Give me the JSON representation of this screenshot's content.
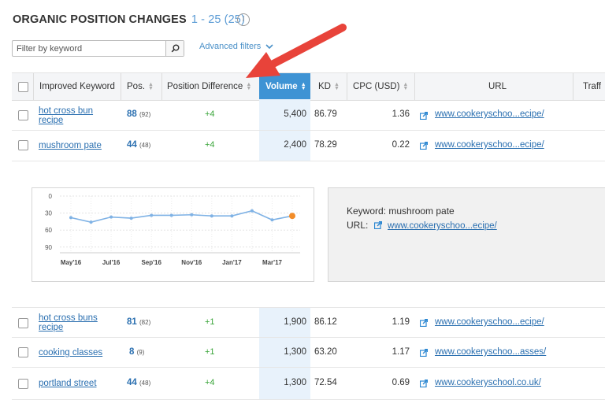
{
  "header": {
    "title": "ORGANIC POSITION CHANGES",
    "range": "1 - 25 (25)",
    "info_glyph": "i"
  },
  "filter": {
    "placeholder": "Filter by keyword",
    "advanced_label": "Advanced filters"
  },
  "table": {
    "columns": {
      "keyword": "Improved Keyword",
      "pos": "Pos.",
      "diff": "Position Difference",
      "volume": "Volume",
      "kd": "KD",
      "cpc": "CPC (USD)",
      "url": "URL",
      "traffic": "Traff"
    },
    "rows_top": [
      {
        "kw1": "hot cross bun",
        "kw2": "recipe",
        "pos": "88",
        "prev": "(92)",
        "diff": "+4",
        "volume": "5,400",
        "kd": "86.79",
        "cpc": "1.36",
        "url": "www.cookeryschoo...ecipe/"
      },
      {
        "kw1": "mushroom pate",
        "kw2": "",
        "pos": "44",
        "prev": "(48)",
        "diff": "+4",
        "volume": "2,400",
        "kd": "78.29",
        "cpc": "0.22",
        "url": "www.cookeryschoo...ecipe/"
      }
    ],
    "rows_bottom": [
      {
        "kw1": "hot cross buns",
        "kw2": "recipe",
        "pos": "81",
        "prev": "(82)",
        "diff": "+1",
        "volume": "1,900",
        "kd": "86.12",
        "cpc": "1.19",
        "url": "www.cookeryschoo...ecipe/"
      },
      {
        "kw1": "cooking classes",
        "kw2": "",
        "pos": "8",
        "prev": "(9)",
        "diff": "+1",
        "volume": "1,300",
        "kd": "63.20",
        "cpc": "1.17",
        "url": "www.cookeryschoo...asses/"
      },
      {
        "kw1": "portland street",
        "kw2": "",
        "pos": "44",
        "prev": "(48)",
        "diff": "+4",
        "volume": "1,300",
        "kd": "72.54",
        "cpc": "0.69",
        "url": "www.cookeryschool.co.uk/"
      }
    ]
  },
  "detail": {
    "keyword_label": "Keyword: mushroom pate",
    "url_label": "URL:",
    "url": "www.cookeryschoo...ecipe/"
  },
  "chart_data": {
    "type": "line",
    "x_ticks": [
      "May'16",
      "Jul'16",
      "Sep'16",
      "Nov'16",
      "Jan'17",
      "Mar'17"
    ],
    "y_ticks": [
      "0",
      "30",
      "60",
      "90"
    ],
    "ylim": [
      0,
      100
    ],
    "y_inverted": true,
    "x": [
      0,
      1,
      2,
      3,
      4,
      5,
      6,
      7,
      8,
      9,
      10,
      11
    ],
    "values": [
      38,
      46,
      37,
      39,
      34,
      34,
      33,
      35,
      35,
      26,
      42,
      35
    ],
    "series_color": "#7fb2e5",
    "last_point_color": "#f28c28"
  },
  "colors": {
    "accent": "#3e93d4",
    "link": "#2a6fb0",
    "positive": "#3aa53a",
    "arrow": "#e8433a"
  }
}
